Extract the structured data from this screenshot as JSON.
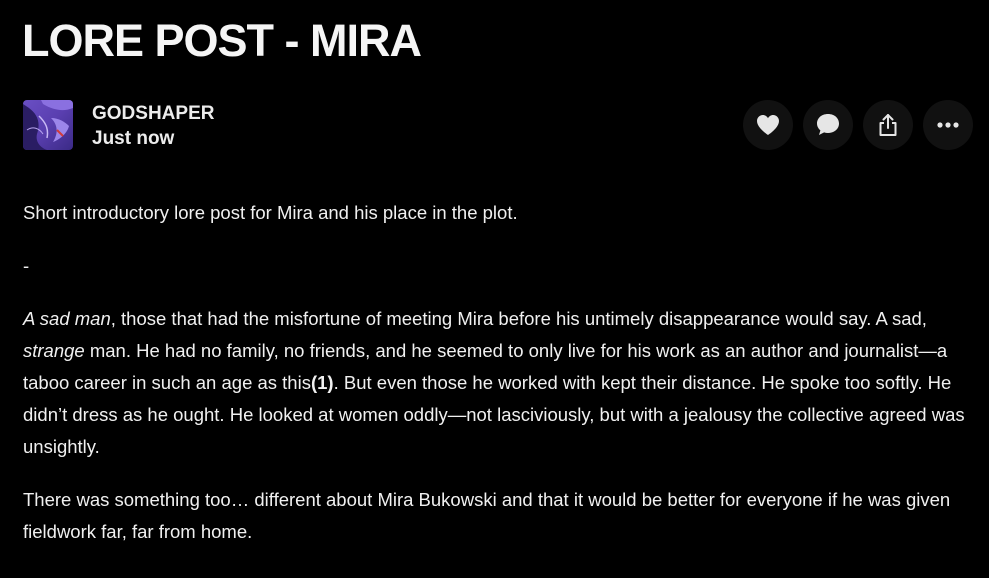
{
  "post": {
    "title": "LORE POST - MIRA",
    "author": {
      "name": "GODSHAPER",
      "time": "Just now",
      "avatar_icon": "avatar-art-icon"
    }
  },
  "actions": [
    {
      "name": "like",
      "icon": "heart-icon"
    },
    {
      "name": "comment",
      "icon": "comment-bubble-icon"
    },
    {
      "name": "share",
      "icon": "share-icon"
    },
    {
      "name": "more",
      "icon": "more-dots-icon"
    }
  ],
  "colors": {
    "background": "#000000",
    "text": "#f0f0f0",
    "button_bg": "#111111",
    "icon": "#e6e6e6"
  },
  "body": {
    "intro": "Short introductory lore post for Mira and his place in the plot.",
    "separator": "-",
    "p1": {
      "em1": "A sad man",
      "t1": ", those that had the misfortune of meeting Mira before his untimely disappearance would say. A sad, ",
      "em2": "strange",
      "t2": " man. He had no family, no friends, and he seemed to only live for his work as an author and journalist—a taboo career in such an age as this",
      "ref": "(1)",
      "t3": ". But even those he worked with kept their distance. He spoke too softly. He didn’t dress as he ought. He looked at women oddly—not lasciviously, but with a jealousy the collective agreed was unsightly."
    },
    "p2": "There was something too… different about Mira Bukowski and that it would be better for everyone if he was given fieldwork far, far from home."
  }
}
